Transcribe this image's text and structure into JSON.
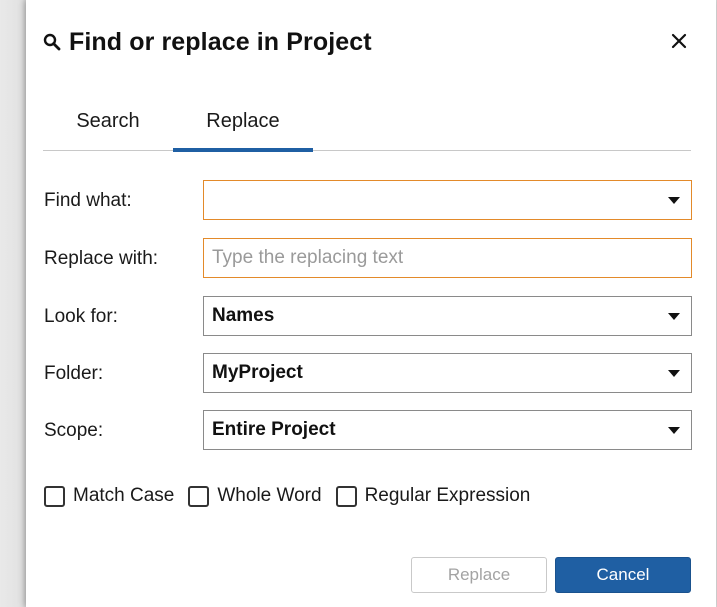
{
  "dialog": {
    "title": "Find or replace in Project",
    "icons": {
      "title": "search-icon",
      "close": "close-icon"
    }
  },
  "tabs": [
    {
      "label": "Search",
      "active": false
    },
    {
      "label": "Replace",
      "active": true
    }
  ],
  "form": {
    "find": {
      "label": "Find what:",
      "value": ""
    },
    "replace": {
      "label": "Replace with:",
      "value": "",
      "placeholder": "Type the replacing text"
    },
    "look_for": {
      "label": "Look for:",
      "value": "Names"
    },
    "folder": {
      "label": "Folder:",
      "value": "MyProject"
    },
    "scope": {
      "label": "Scope:",
      "value": "Entire Project"
    }
  },
  "options": [
    {
      "label": "Match Case",
      "checked": false
    },
    {
      "label": "Whole Word",
      "checked": false
    },
    {
      "label": "Regular Expression",
      "checked": false
    }
  ],
  "buttons": {
    "replace": {
      "label": "Replace",
      "disabled": true
    },
    "cancel": {
      "label": "Cancel"
    }
  },
  "colors": {
    "accent": "#1f5fa3",
    "focus_border": "#e38a2a",
    "disabled_text": "#a3a3a3"
  }
}
